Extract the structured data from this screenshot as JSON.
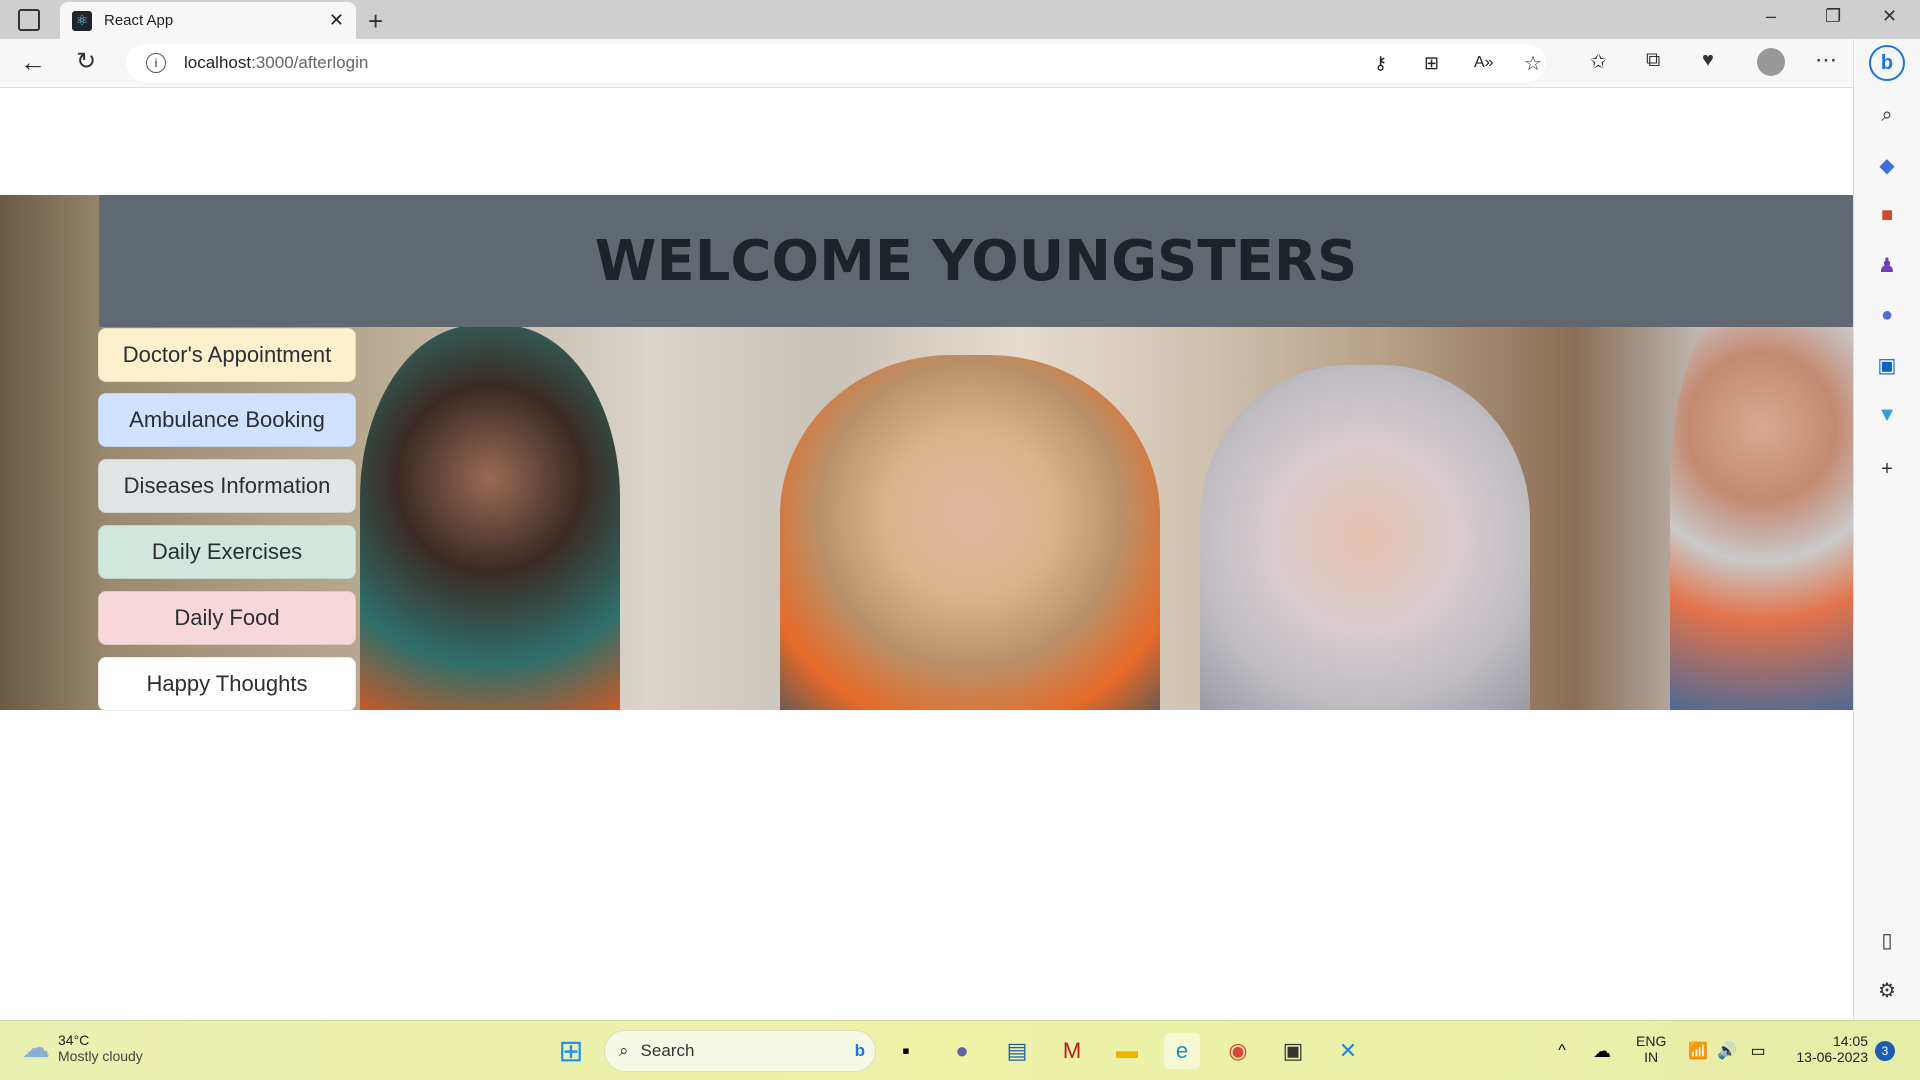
{
  "browser": {
    "tab_title": "React App",
    "url_host": "localhost",
    "url_path": ":3000/afterlogin"
  },
  "page": {
    "title": "WELCOME YOUNGSTERS",
    "menu": [
      {
        "label": "Doctor's Appointment",
        "color": "#fdf0cd"
      },
      {
        "label": "Ambulance Booking",
        "color": "#cfe2ff"
      },
      {
        "label": "Diseases Information",
        "color": "#e2e3e5"
      },
      {
        "label": "Daily Exercises",
        "color": "#d1e7dd"
      },
      {
        "label": "Daily Food",
        "color": "#f8d7da"
      },
      {
        "label": "Happy Thoughts",
        "color": "#ffffff"
      }
    ]
  },
  "taskbar": {
    "weather_temp": "34°C",
    "weather_desc": "Mostly cloudy",
    "search_placeholder": "Search",
    "lang_top": "ENG",
    "lang_bottom": "IN",
    "time": "14:05",
    "date": "13-06-2023",
    "notifications": "3"
  }
}
